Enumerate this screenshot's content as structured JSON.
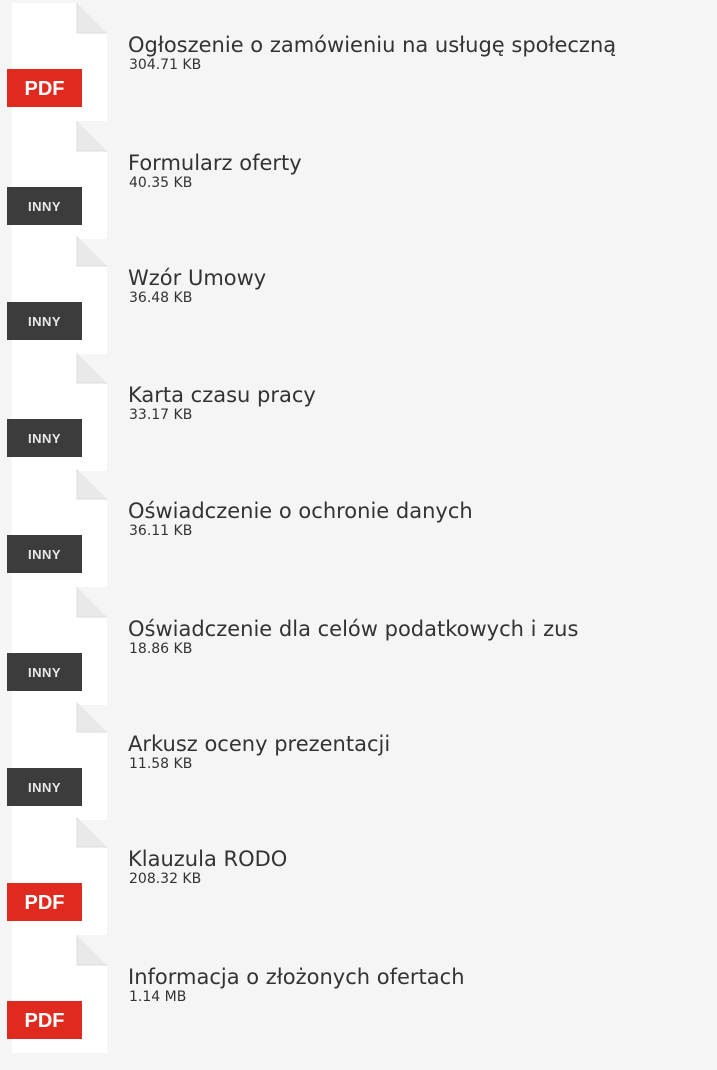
{
  "files": [
    {
      "name": "Ogłoszenie o zamówieniu na usługę społeczną",
      "size": "304.71 KB",
      "type": "PDF",
      "color": "#e02a1f"
    },
    {
      "name": "Formularz oferty",
      "size": "40.35 KB",
      "type": "INNY",
      "color": "#3c3c3c"
    },
    {
      "name": "Wzór Umowy",
      "size": "36.48 KB",
      "type": "INNY",
      "color": "#3c3c3c"
    },
    {
      "name": "Karta czasu pracy",
      "size": "33.17 KB",
      "type": "INNY",
      "color": "#3c3c3c"
    },
    {
      "name": "Oświadczenie o ochronie danych",
      "size": "36.11 KB",
      "type": "INNY",
      "color": "#3c3c3c"
    },
    {
      "name": "Oświadczenie dla celów podatkowych i zus",
      "size": "18.86 KB",
      "type": "INNY",
      "color": "#3c3c3c"
    },
    {
      "name": "Arkusz oceny prezentacji",
      "size": "11.58 KB",
      "type": "INNY",
      "color": "#3c3c3c"
    },
    {
      "name": "Klauzula RODO",
      "size": "208.32 KB",
      "type": "PDF",
      "color": "#e02a1f"
    },
    {
      "name": "Informacja o złożonych ofertach",
      "size": "1.14 MB",
      "type": "PDF",
      "color": "#e02a1f"
    }
  ]
}
